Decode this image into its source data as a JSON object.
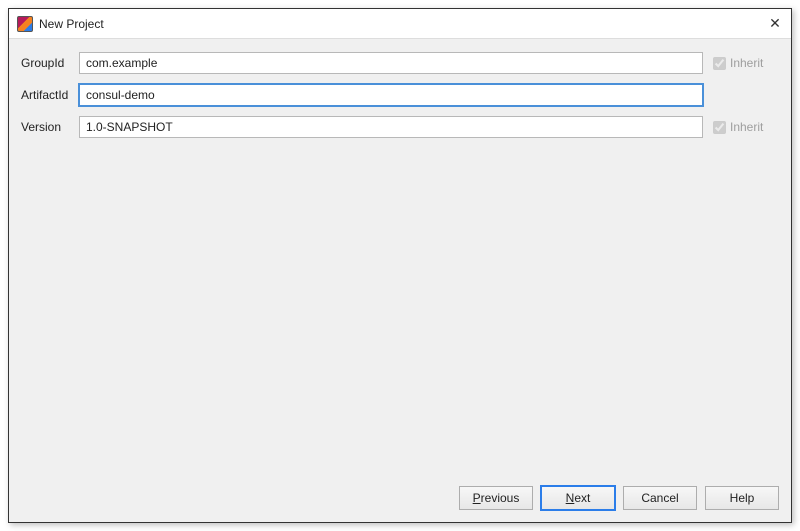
{
  "window": {
    "title": "New Project",
    "close_label": "✕"
  },
  "form": {
    "groupId": {
      "label": "GroupId",
      "value": "com.example",
      "inherit_label": "Inherit"
    },
    "artifactId": {
      "label": "ArtifactId",
      "value": "consul-demo"
    },
    "version": {
      "label": "Version",
      "value": "1.0-SNAPSHOT",
      "inherit_label": "Inherit"
    }
  },
  "buttons": {
    "previous": {
      "mnemonic": "P",
      "rest": "revious"
    },
    "next": {
      "mnemonic": "N",
      "rest": "ext"
    },
    "cancel": {
      "label": "Cancel"
    },
    "help": {
      "label": "Help"
    }
  }
}
